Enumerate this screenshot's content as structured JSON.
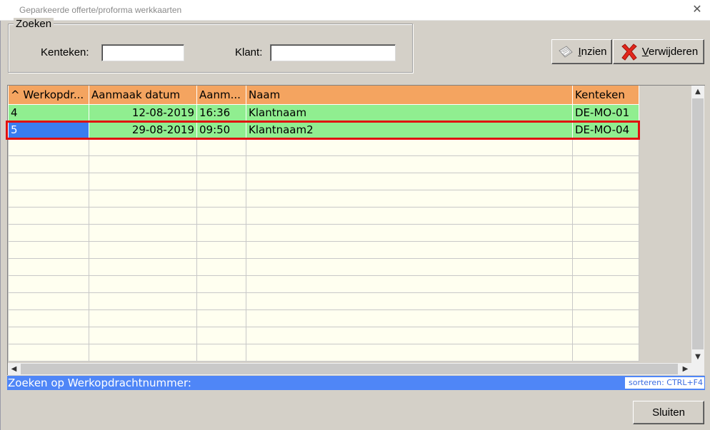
{
  "window": {
    "title": "Geparkeerde offerte/proforma werkkaarten",
    "close_glyph": "✕"
  },
  "search": {
    "legend": "Zoeken",
    "kenteken_label": "Kenteken:",
    "kenteken_value": "",
    "klant_label": "Klant:",
    "klant_value": ""
  },
  "toolbar": {
    "inzien_label": "nzien",
    "inzien_mnemonic": "I",
    "inzien_icon": "view-document-icon",
    "verwijderen_label": "erwijderen",
    "verwijderen_mnemonic": "V",
    "verwijderen_icon": "red-x-icon"
  },
  "grid": {
    "columns": [
      "^ Werkopdr...",
      "Aanmaak datum",
      "Aanm...",
      "Naam",
      "Kenteken"
    ],
    "rows": [
      {
        "werkopdracht": "4",
        "datum": "12-08-2019",
        "tijd": "16:36",
        "naam": "Klantnaam",
        "kenteken": "DE-MO-01"
      },
      {
        "werkopdracht": "5",
        "datum": "29-08-2019",
        "tijd": "09:50",
        "naam": "Klantnaam2",
        "kenteken": "DE-MO-04"
      }
    ],
    "selected_row": 1,
    "header_color": "#f4a460",
    "row_color": "#90ee90",
    "empty_row_color": "#fffff0",
    "selection_color": "#3a7df0"
  },
  "status": {
    "text": "Zoeken op Werkopdrachtnummer:",
    "sort_hint": "sorteren: CTRL+F4"
  },
  "footer": {
    "sluiten_label": "Sluiten"
  }
}
